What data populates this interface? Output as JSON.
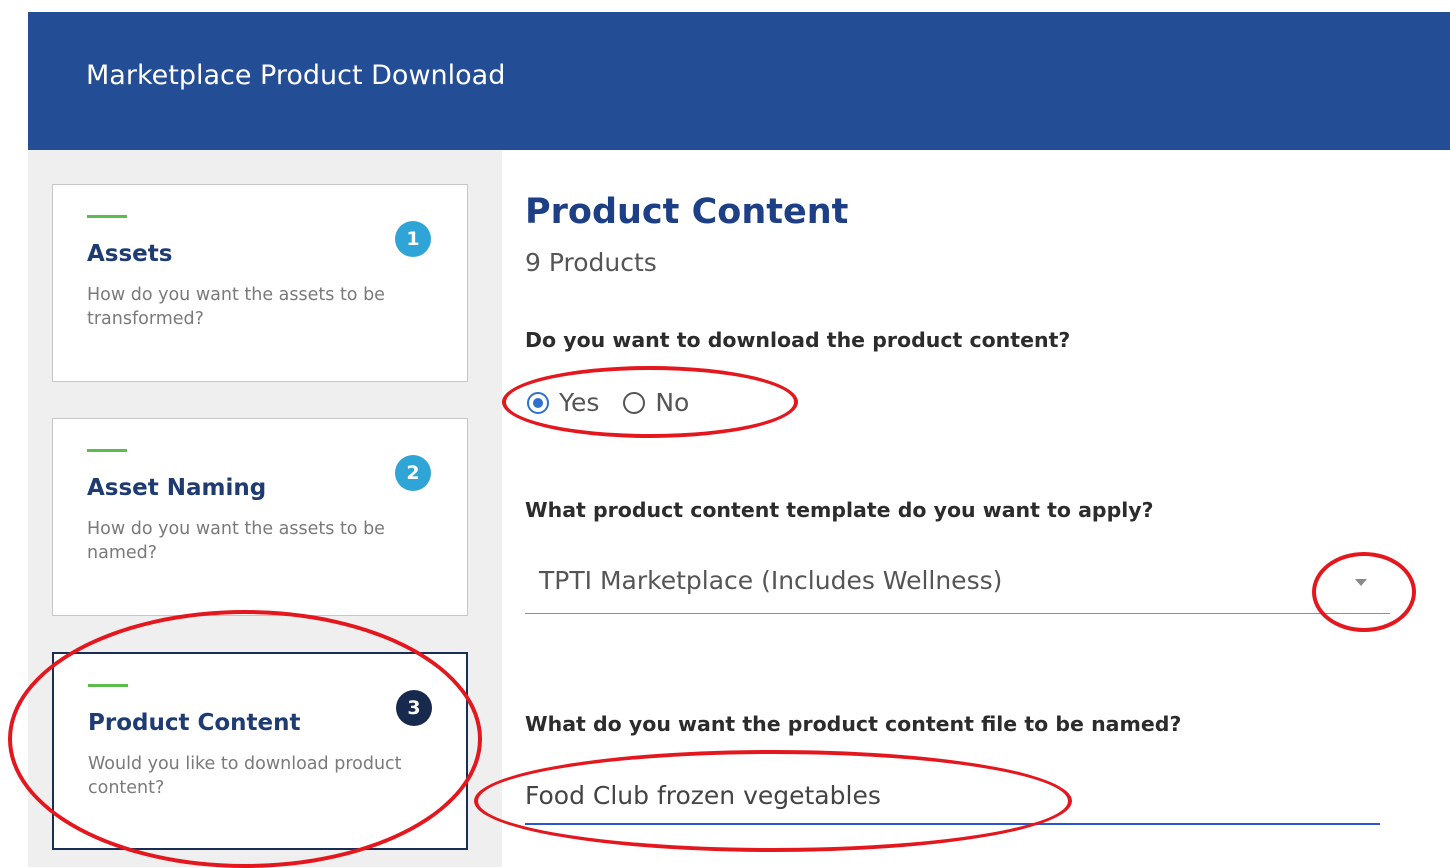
{
  "header": {
    "title": "Marketplace Product Download"
  },
  "steps": [
    {
      "number": "1",
      "title": "Assets",
      "description": "How do you want the assets to be transformed?"
    },
    {
      "number": "2",
      "title": "Asset Naming",
      "description": "How do you want the assets to be named?"
    },
    {
      "number": "3",
      "title": "Product Content",
      "description": "Would you like to download product content?"
    }
  ],
  "main": {
    "title": "Product Content",
    "product_count": "9 Products",
    "download_question": "Do you want to download the product content?",
    "radio": {
      "yes": "Yes",
      "no": "No",
      "selected": "Yes"
    },
    "template_question": "What product content template do you want to apply?",
    "template_value": "TPTI Marketplace (Includes Wellness)",
    "filename_question": "What do you want the product content file to be named?",
    "filename_value": "Food Club frozen vegetables"
  },
  "colors": {
    "header_bg": "#234e96",
    "accent_green": "#5cbd4e",
    "badge_blue": "#2fa4d6",
    "badge_dark": "#172a4d",
    "annotation_red": "#e3171d"
  }
}
